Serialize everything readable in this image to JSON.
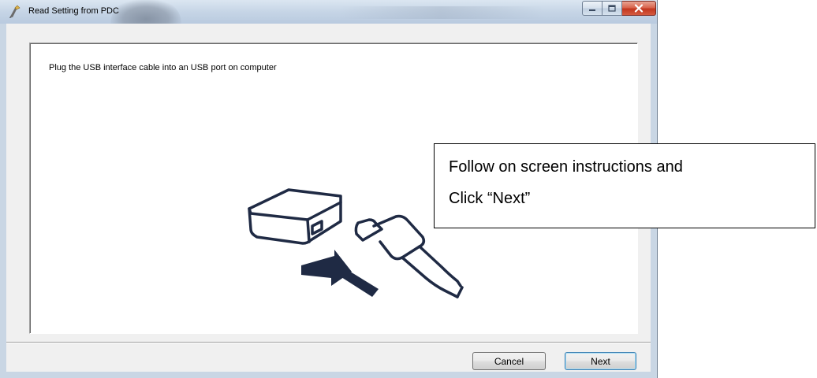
{
  "window": {
    "title": "Read Setting from PDC",
    "controls": {
      "minimize": "minimize",
      "maximize": "maximize",
      "close": "close"
    }
  },
  "content": {
    "instruction": "Plug the USB interface cable into an USB port on computer",
    "illustration": "usb-plug-into-device-icon"
  },
  "footer": {
    "cancel_label": "Cancel",
    "next_label": "Next"
  },
  "callout": {
    "line1": "Follow on screen instructions and",
    "line2": "Click “Next”"
  },
  "colors": {
    "titlebar": "#c6d5e6",
    "window_frame": "#c9d6e4",
    "client_bg": "#f0f0f0",
    "close_button": "#c2371f",
    "illustration": "#1f2a44",
    "default_button_border": "#3c7fb1"
  }
}
